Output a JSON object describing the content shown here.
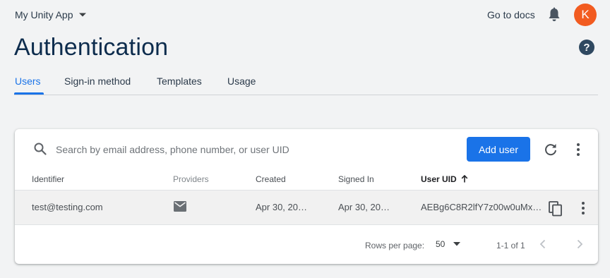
{
  "header": {
    "project_name": "My Unity App",
    "docs_link": "Go to docs",
    "avatar_initial": "K",
    "avatar_color": "#f25b20"
  },
  "page": {
    "title": "Authentication",
    "help_icon": "question-circle-icon"
  },
  "tabs": [
    {
      "label": "Users",
      "active": true
    },
    {
      "label": "Sign-in method",
      "active": false
    },
    {
      "label": "Templates",
      "active": false
    },
    {
      "label": "Usage",
      "active": false
    }
  ],
  "toolbar": {
    "search_placeholder": "Search by email address, phone number, or user UID",
    "add_user_label": "Add user",
    "accent_color": "#1a73e8"
  },
  "table": {
    "columns": [
      "Identifier",
      "Providers",
      "Created",
      "Signed In",
      "User UID"
    ],
    "sorted_column": "User UID",
    "sort_direction": "ascending",
    "rows": [
      {
        "identifier": "test@testing.com",
        "provider_icon": "email-icon",
        "created": "Apr 30, 20…",
        "signed_in": "Apr 30, 20…",
        "uid": "AEBg6C8R2lfY7z00w0uMx…"
      }
    ]
  },
  "pagination": {
    "rows_per_page_label": "Rows per page:",
    "rows_per_page_value": "50",
    "range_text": "1-1 of 1"
  }
}
